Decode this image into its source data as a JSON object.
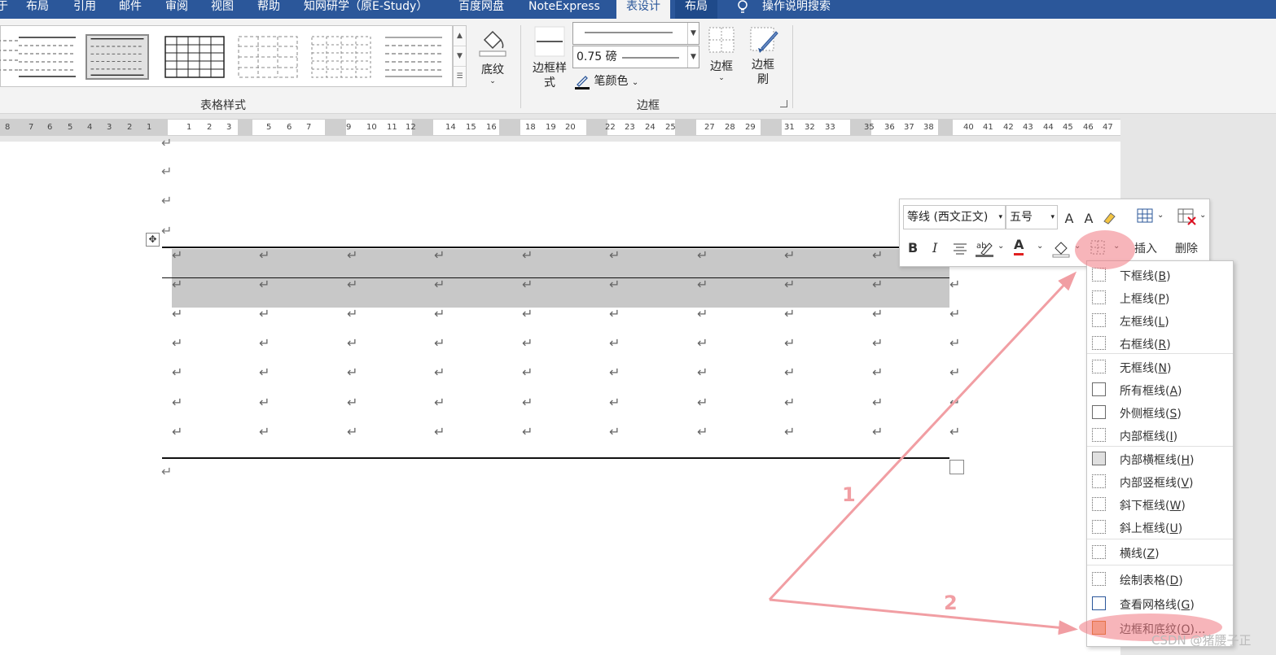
{
  "tabs": [
    "于",
    "布局",
    "引用",
    "邮件",
    "审阅",
    "视图",
    "帮助",
    "知网研学（原E-Study）",
    "百度网盘",
    "NoteExpress",
    "表设计",
    "布局",
    "操作说明搜索"
  ],
  "ribbon": {
    "shading_label": "底纹",
    "table_styles_label": "表格样式",
    "border_style_label": "边框样式",
    "pen_weight": "0.75 磅",
    "pen_color_label": "笔颜色",
    "borders_label": "边框",
    "border_painter_label": "边框刷",
    "borders_group_label": "边框"
  },
  "ruler": [
    "8",
    "7",
    "6",
    "5",
    "4",
    "3",
    "2",
    "1",
    "1",
    "2",
    "3",
    "5",
    "6",
    "7",
    "9",
    "10",
    "11",
    "12",
    "14",
    "15",
    "16",
    "18",
    "19",
    "20",
    "22",
    "23",
    "24",
    "25",
    "27",
    "28",
    "29",
    "31",
    "32",
    "33",
    "35",
    "36",
    "37",
    "38",
    "40",
    "41",
    "42",
    "43",
    "44",
    "45",
    "46",
    "47"
  ],
  "mini_toolbar": {
    "font": "等线 (西文正文)",
    "size": "五号",
    "grow_font": "A",
    "shrink_font": "A",
    "bold": "B",
    "italic": "I",
    "font_color": "A",
    "insert_label": "插入",
    "delete_label": "删除"
  },
  "menu": [
    {
      "text": "下框线(",
      "key": "B",
      "end": ")"
    },
    {
      "text": "上框线(",
      "key": "P",
      "end": ")"
    },
    {
      "text": "左框线(",
      "key": "L",
      "end": ")"
    },
    {
      "text": "右框线(",
      "key": "R",
      "end": ")"
    },
    {
      "text": "无框线(",
      "key": "N",
      "end": ")"
    },
    {
      "text": "所有框线(",
      "key": "A",
      "end": ")"
    },
    {
      "text": "外侧框线(",
      "key": "S",
      "end": ")"
    },
    {
      "text": "内部框线(",
      "key": "I",
      "end": ")"
    },
    {
      "text": "内部横框线(",
      "key": "H",
      "end": ")"
    },
    {
      "text": "内部竖框线(",
      "key": "V",
      "end": ")"
    },
    {
      "text": "斜下框线(",
      "key": "W",
      "end": ")"
    },
    {
      "text": "斜上框线(",
      "key": "U",
      "end": ")"
    },
    {
      "text": "横线(",
      "key": "Z",
      "end": ")"
    },
    {
      "text": "绘制表格(",
      "key": "D",
      "end": ")"
    },
    {
      "text": "查看网格线(",
      "key": "G",
      "end": ")"
    },
    {
      "text": "边框和底纹(",
      "key": "O",
      "end": ")..."
    }
  ],
  "annotations": {
    "step1": "1",
    "step2": "2"
  },
  "watermark": "CSDN @猪腰子正",
  "colors": {
    "tab_bar": "#2b579a",
    "highlight": "#f0787f",
    "arrow": "#f19ea3"
  }
}
